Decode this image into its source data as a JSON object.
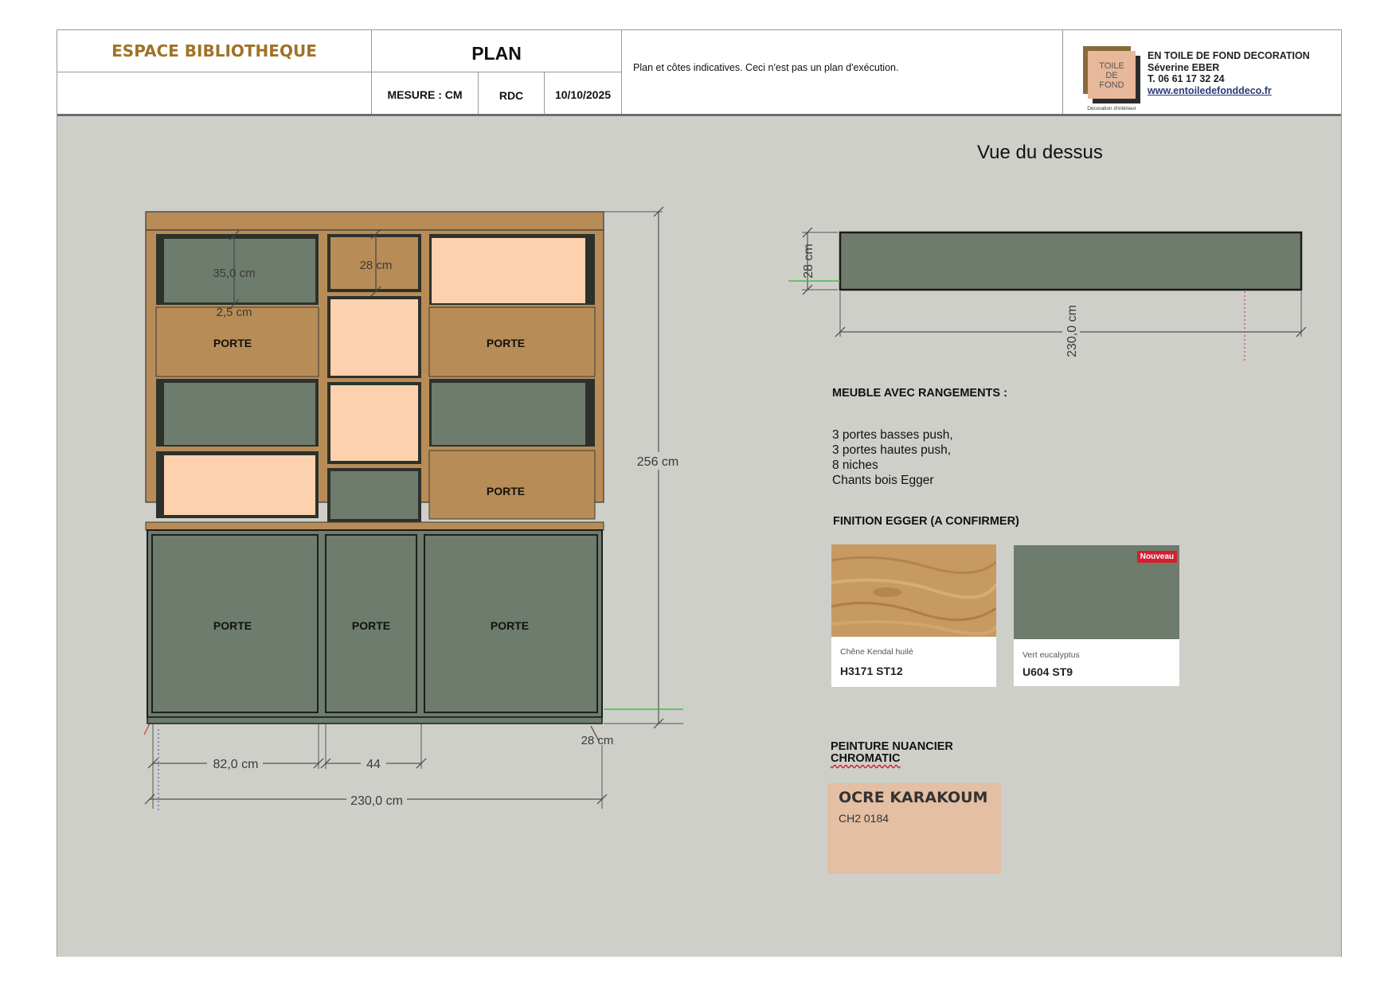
{
  "header": {
    "brand": "ESPACE BIBLIOTHEQUE",
    "plan_title": "PLAN",
    "measure": "MESURE : CM",
    "level": "RDC",
    "date": "10/10/2025",
    "note": "Plan et côtes indicatives. Ceci n'est pas un plan d'exécution."
  },
  "company": {
    "name": "EN TOILE DE FOND DECORATION",
    "person": "Séverine EBER",
    "phone": "T. 06 61 17 32 24",
    "website": "www.entoiledefonddeco.fr",
    "logo_text": [
      "TOILE",
      "DE",
      "FOND"
    ],
    "logo_caption": "Décoration d'intérieur"
  },
  "elevation": {
    "door_label": "PORTE",
    "dimensions": {
      "niche_height": "35,0 cm",
      "shelf_thickness": "2,5 cm",
      "middle_niche": "28 cm",
      "total_height": "256 cm",
      "depth": "28 cm",
      "left_width": "82,0 cm",
      "middle_width": "44",
      "total_width": "230,0 cm"
    }
  },
  "top_view": {
    "title": "Vue du dessus",
    "depth": "28 cm",
    "width": "230,0 cm"
  },
  "specs": {
    "heading": "MEUBLE AVEC RANGEMENTS :",
    "lines": [
      "3 portes basses push,",
      "3 portes hautes push,",
      "8 niches",
      "Chants bois Egger"
    ],
    "finition_heading": "FINITION EGGER (A CONFIRMER)"
  },
  "swatches": [
    {
      "name": "Chêne Kendal huilé",
      "code": "H3171 ST12",
      "color": "#c79a62"
    },
    {
      "name": "Vert eucalyptus",
      "code": "U604 ST9",
      "color": "#6e7c6d",
      "badge": "Nouveau"
    }
  ],
  "paint": {
    "heading_line1": "PEINTURE NUANCIER",
    "heading_line2": "CHROMATIC",
    "name": "OCRE KARAKOUM",
    "code": "CH2 0184",
    "color": "#e4bfa3"
  },
  "colors": {
    "oak": "#b88c56",
    "green": "#6e7c6d",
    "peach": "#fdd1ad",
    "dark": "#2c312b",
    "background": "#cfcfca"
  }
}
